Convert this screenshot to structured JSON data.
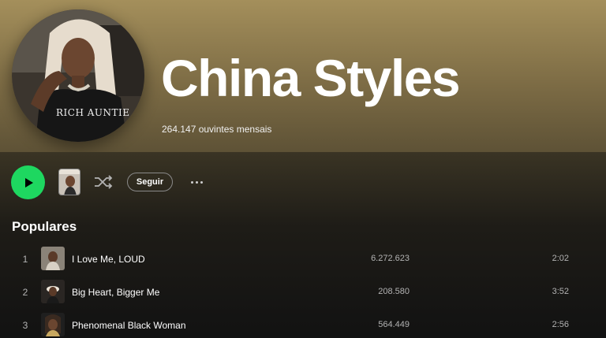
{
  "artist": {
    "name": "China Styles",
    "monthly_listeners": "264.147 ouvintes mensais",
    "avatar_shirt_text": "RICH AUNTIE"
  },
  "controls": {
    "play_icon": "play-icon",
    "shuffle_icon": "shuffle-icon",
    "follow_label": "Seguir",
    "more_icon": "more-options-icon"
  },
  "popular": {
    "title": "Populares",
    "tracks": [
      {
        "number": "1",
        "title": "I Love Me, LOUD",
        "plays": "6.272.623",
        "duration": "2:02"
      },
      {
        "number": "2",
        "title": "Big Heart, Bigger Me",
        "plays": "208.580",
        "duration": "3:52"
      },
      {
        "number": "3",
        "title": "Phenomenal Black Woman",
        "plays": "564.449",
        "duration": "2:56"
      }
    ]
  },
  "colors": {
    "accent": "#1ed760",
    "hero_top": "#a48f5b",
    "hero_bottom": "#5e5236",
    "background": "#121212",
    "secondary_text": "#b3b3b3"
  }
}
